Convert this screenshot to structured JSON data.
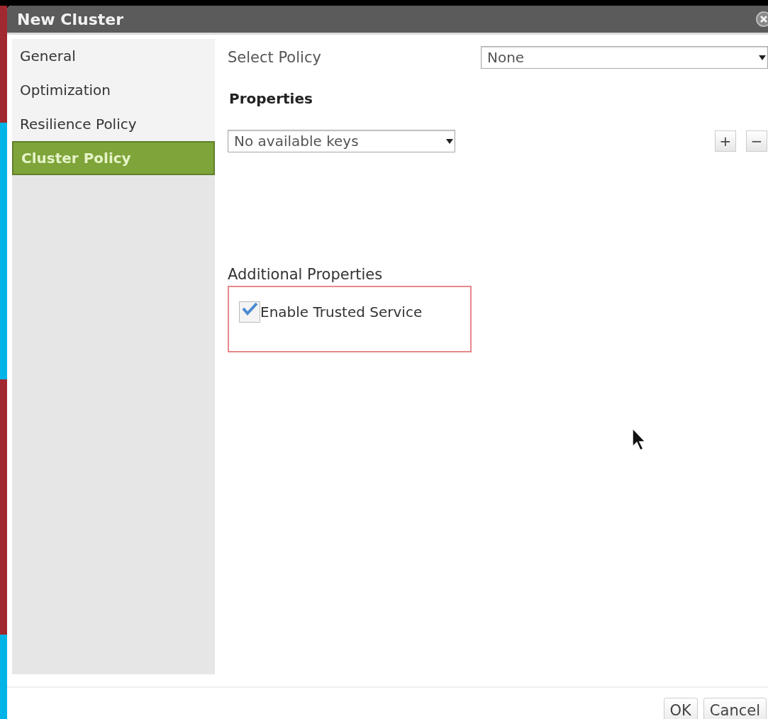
{
  "window": {
    "title": "New Cluster"
  },
  "sidebar": {
    "items": [
      {
        "label": "General",
        "selected": false
      },
      {
        "label": "Optimization",
        "selected": false
      },
      {
        "label": "Resilience Policy",
        "selected": false
      },
      {
        "label": "Cluster Policy",
        "selected": true
      }
    ]
  },
  "select_policy": {
    "label": "Select Policy",
    "value": "None"
  },
  "properties": {
    "heading": "Properties",
    "key_select": {
      "value": "No available keys"
    },
    "add_button": "+",
    "remove_button": "−"
  },
  "additional_properties": {
    "heading": "Additional Properties",
    "options": [
      {
        "label": "Enable Trusted Service",
        "checked": true
      }
    ]
  },
  "buttons": [
    {
      "label": "OK"
    },
    {
      "label": "Cancel"
    }
  ]
}
